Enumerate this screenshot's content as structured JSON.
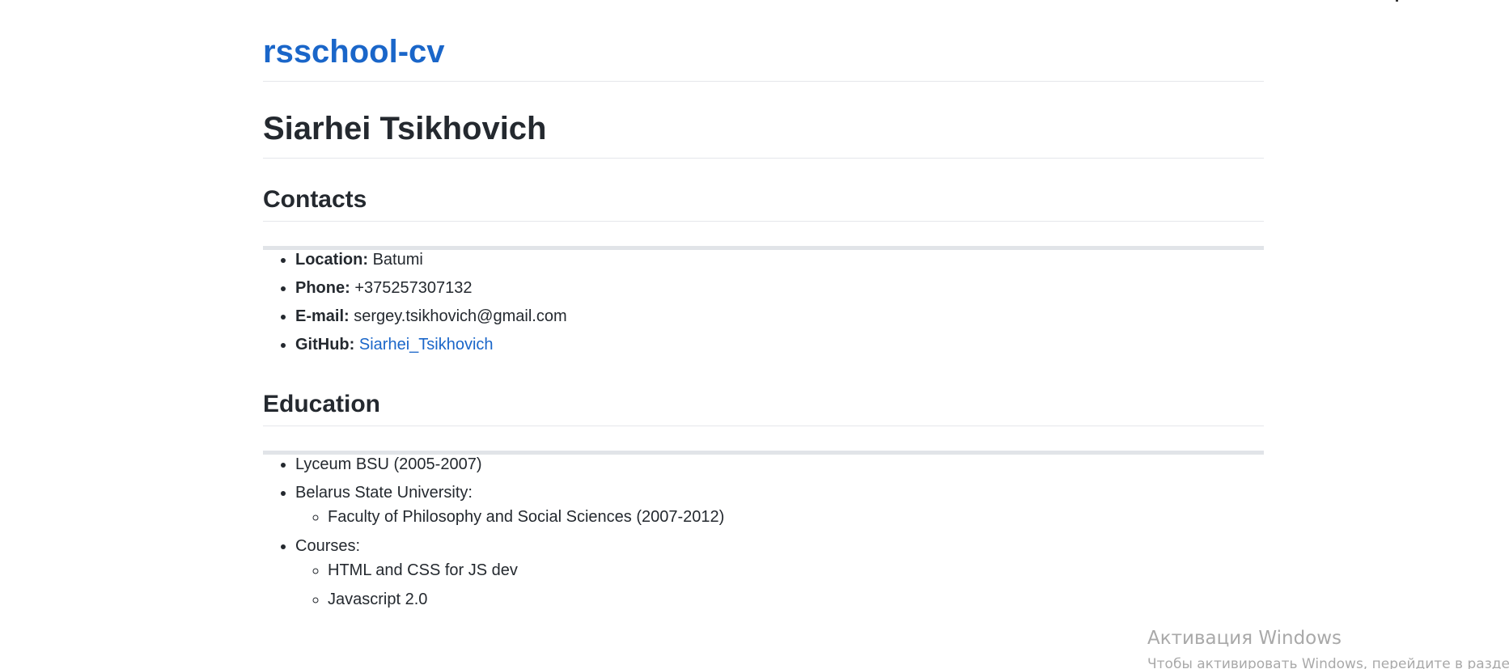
{
  "site": {
    "title": "rsschool-cv"
  },
  "profile": {
    "name": "Siarhei Tsikhovich"
  },
  "contacts": {
    "heading": "Contacts",
    "items": [
      {
        "label": "Location:",
        "value": "Batumi"
      },
      {
        "label": "Phone:",
        "value": "+375257307132"
      },
      {
        "label": "E-mail:",
        "value": "sergey.tsikhovich@gmail.com"
      },
      {
        "label": "GitHub:",
        "link_text": "Siarhei_Tsikhovich"
      }
    ]
  },
  "education": {
    "heading": "Education",
    "items": [
      {
        "text": "Lyceum BSU (2005-2007)"
      },
      {
        "text": "Belarus State University:",
        "sub": [
          "Faculty of Philosophy and Social Sciences (2007-2012)"
        ]
      },
      {
        "text": "Courses:",
        "sub": [
          "HTML and CSS for JS dev",
          "Javascript 2.0"
        ]
      }
    ]
  },
  "windows_activation": {
    "title": "Активация Windows",
    "subtitle": "Чтобы активировать Windows, перейдите в раздел"
  },
  "colors": {
    "link": "#1a66c9",
    "text": "#24292f",
    "rule": "#e1e4e8"
  }
}
